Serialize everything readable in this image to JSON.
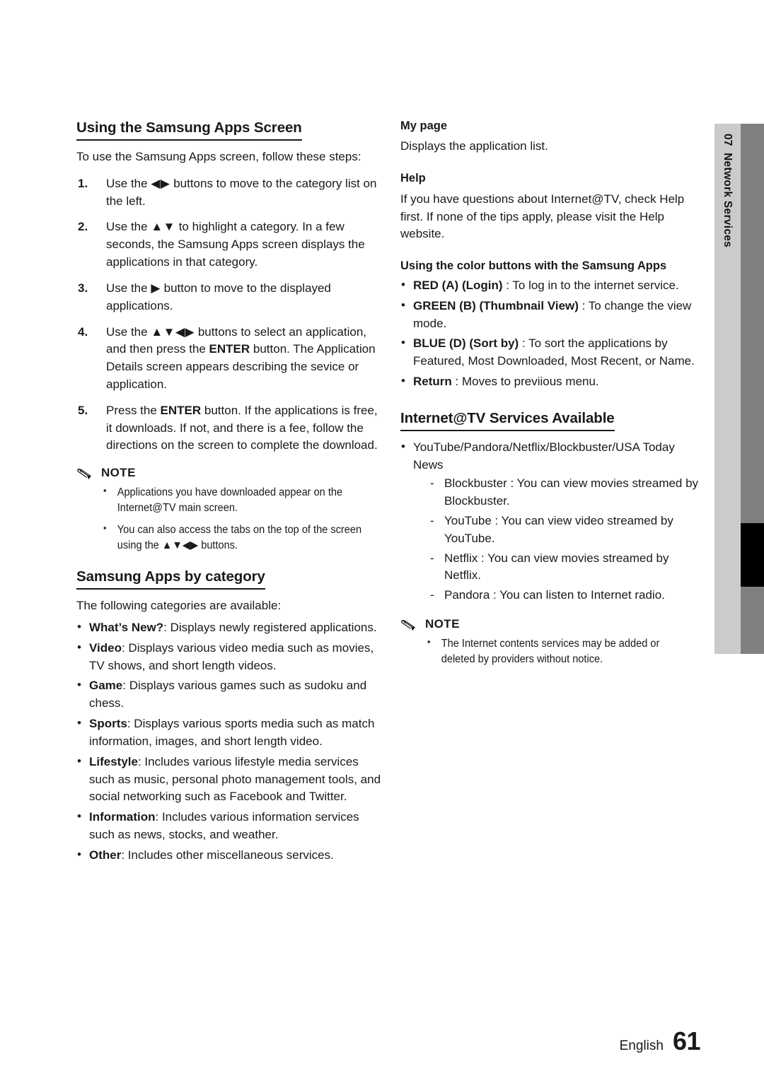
{
  "sidebar": {
    "chapter_number": "07",
    "chapter_title": "Network Services",
    "colors": {
      "inner": "#cbcbcb",
      "outer": "#808080",
      "marker": "#000000"
    }
  },
  "left_column": {
    "heading": "Using the Samsung Apps Screen",
    "intro": "To use the Samsung Apps screen, follow these steps:",
    "steps": [
      {
        "num": "1.",
        "html": "Use the <span class=\"arrows\">◀▶</span> buttons to move to the category list on the left."
      },
      {
        "num": "2.",
        "html": "Use the <span class=\"arrows\">▲▼</span> to highlight a category. In a few seconds, the Samsung Apps screen displays the applications in that category."
      },
      {
        "num": "3.",
        "html": "Use the <span class=\"arrows\">▶</span> button to move to the displayed applications."
      },
      {
        "num": "4.",
        "html": "Use the <span class=\"arrows\">▲▼◀▶</span> buttons to select an application, and then press the <b>ENTER</b> button. The Application Details screen appears describing the sevice or application."
      },
      {
        "num": "5.",
        "html": "Press the <b>ENTER</b> button. If the applications is free, it downloads. If not, and there is a fee, follow the directions on the screen to complete the download."
      }
    ],
    "note": {
      "title": "NOTE",
      "items": [
        "Applications you have downloaded appear on the Internet@TV main screen.",
        "You can also access the tabs on the top of the screen using the ▲▼◀▶ buttons."
      ]
    },
    "heading2": "Samsung Apps by category",
    "intro2": "The following categories are available:",
    "categories": [
      {
        "html": "<b>What’s New?</b>: Displays newly registered applications."
      },
      {
        "html": "<b>Video</b>: Displays various video media such as movies, TV shows, and short length videos."
      },
      {
        "html": "<b>Game</b>: Displays various games such as sudoku and chess."
      },
      {
        "html": "<b>Sports</b>: Displays various sports media such as match information, images, and short length video."
      },
      {
        "html": "<b>Lifestyle</b>: Includes various lifestyle media services such as music, personal photo management tools, and social networking such as Facebook and Twitter."
      },
      {
        "html": "<b>Information</b>: Includes various information services such as news, stocks, and weather."
      },
      {
        "html": "<b>Other</b>: Includes other miscellaneous services."
      }
    ]
  },
  "right_column": {
    "my_page_heading": "My page",
    "my_page_body": "Displays the application list.",
    "help_heading": "Help",
    "help_body": "If you have questions about Internet@TV, check Help first. If none of the tips apply, please visit the Help website.",
    "color_buttons_heading": "Using the color buttons with the Samsung Apps",
    "color_buttons": [
      {
        "html": "<b>RED (A) (Login)</b> : To log in to the internet service."
      },
      {
        "html": "<b>GREEN (B) (Thumbnail View)</b> : To change the view mode."
      },
      {
        "html": "<b>BLUE (D) (Sort by)</b> : To sort the applications by Featured, Most Downloaded, Most Recent, or Name."
      },
      {
        "html": "<b>Return</b> : Moves to previious menu."
      }
    ],
    "services_heading": "Internet@TV Services Available",
    "services_main": "YouTube/Pandora/Netflix/Blockbuster/USA Today News",
    "services_sub": [
      "Blockbuster : You can view movies streamed by Blockbuster.",
      "YouTube : You can view video streamed by YouTube.",
      "Netflix : You can view movies streamed by Netflix.",
      "Pandora : You can listen to Internet radio."
    ],
    "note": {
      "title": "NOTE",
      "items": [
        "The Internet contents services may be added or deleted by providers without notice."
      ]
    }
  },
  "footer": {
    "language": "English",
    "page_number": "61"
  }
}
